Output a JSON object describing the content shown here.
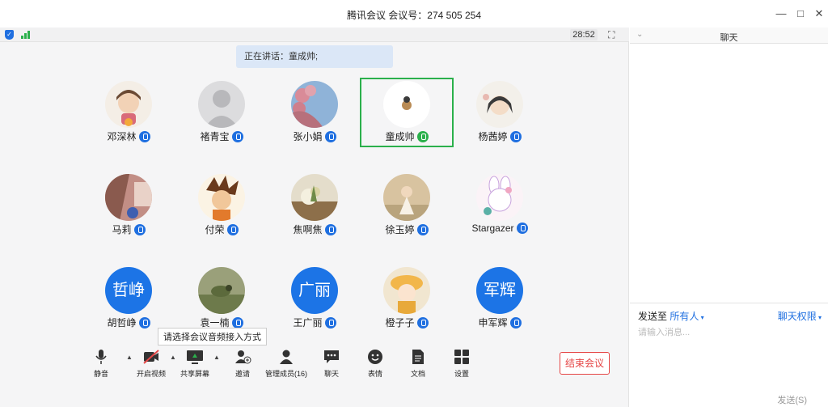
{
  "window": {
    "title": "腾讯会议 会议号：274 505 254",
    "minimize": "—",
    "maximize": "□",
    "close": "✕"
  },
  "status": {
    "timer": "28:52",
    "fullscreen_icon": "⛶"
  },
  "speaking": "正在讲话：童成帅;",
  "participants": [
    {
      "name": "邓深林",
      "avatar": "photo",
      "color": "#e8d9c7"
    },
    {
      "name": "褚青宝",
      "avatar": "default",
      "color": "#d6d6d8"
    },
    {
      "name": "张小娟",
      "avatar": "photo",
      "color": "#b7c8dc"
    },
    {
      "name": "童成帅",
      "avatar": "photo",
      "color": "#f3efe8"
    },
    {
      "name": "杨茜婷",
      "avatar": "photo",
      "color": "#eae4da"
    },
    {
      "name": "马莉",
      "avatar": "photo",
      "color": "#c98f86"
    },
    {
      "name": "付荣",
      "avatar": "photo",
      "color": "#f1e2c9"
    },
    {
      "name": "焦啊焦",
      "avatar": "photo",
      "color": "#d7cdb6"
    },
    {
      "name": "徐玉婷",
      "avatar": "photo",
      "color": "#d9c3a5"
    },
    {
      "name": "Stargazer",
      "avatar": "photo",
      "color": "#f4e8ef"
    },
    {
      "name": "胡哲峥",
      "avatar": "text",
      "initials": "哲峥"
    },
    {
      "name": "袁一楠",
      "avatar": "photo",
      "color": "#8e9a6f"
    },
    {
      "name": "王广丽",
      "avatar": "text",
      "initials": "广丽"
    },
    {
      "name": "橙子子",
      "avatar": "photo",
      "color": "#efe1c8"
    },
    {
      "name": "申军辉",
      "avatar": "text",
      "initials": "军辉"
    }
  ],
  "tooltip": "请选择会议音频接入方式",
  "toolbar": {
    "mute": "静音",
    "video": "开启视频",
    "share": "共享屏幕",
    "invite": "邀请",
    "members": "管理成员(16)",
    "chat": "聊天",
    "emoji": "表情",
    "docs": "文档",
    "settings": "设置",
    "end": "结束会议"
  },
  "chat": {
    "title": "聊天",
    "send_to_label": "发送至",
    "send_to_value": "所有人",
    "permission": "聊天权限",
    "input_placeholder": "请输入消息...",
    "send_button": "发送(S)"
  },
  "colors": {
    "accent": "#1f6fe0",
    "active_border": "#2bb04b",
    "end_red": "#e54545"
  }
}
